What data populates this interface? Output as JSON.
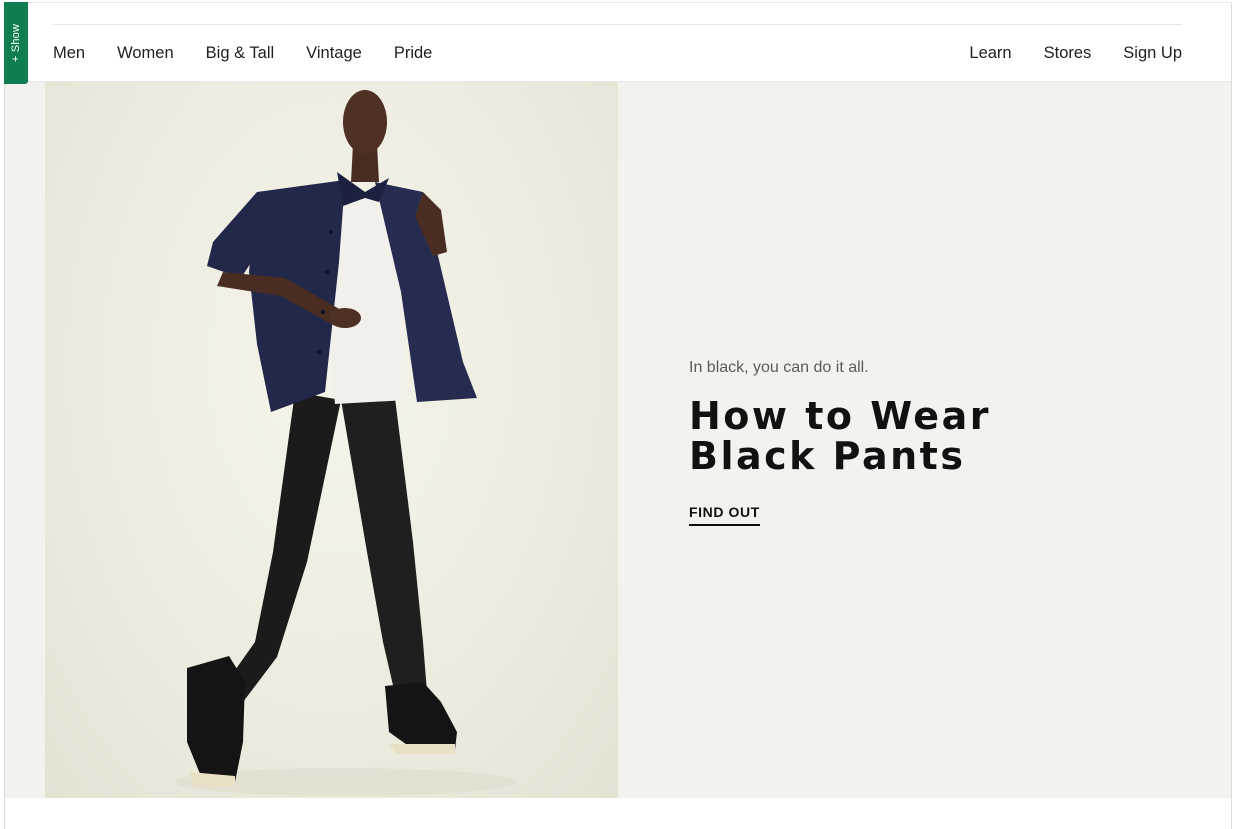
{
  "feedback_tab": {
    "label": "+ Show"
  },
  "nav": {
    "left": [
      {
        "label": "Men"
      },
      {
        "label": "Women"
      },
      {
        "label": "Big & Tall"
      },
      {
        "label": "Vintage"
      },
      {
        "label": "Pride"
      }
    ],
    "right": [
      {
        "label": "Learn"
      },
      {
        "label": "Stores"
      },
      {
        "label": "Sign Up"
      }
    ]
  },
  "hero": {
    "eyebrow": "In black, you can do it all.",
    "headline_line1": "How to Wear",
    "headline_line2": "Black Pants",
    "cta": "FIND OUT"
  },
  "colors": {
    "accent_tab": "#0e7d4f",
    "hero_background": "#f3f2ee",
    "text_primary": "#111111"
  }
}
